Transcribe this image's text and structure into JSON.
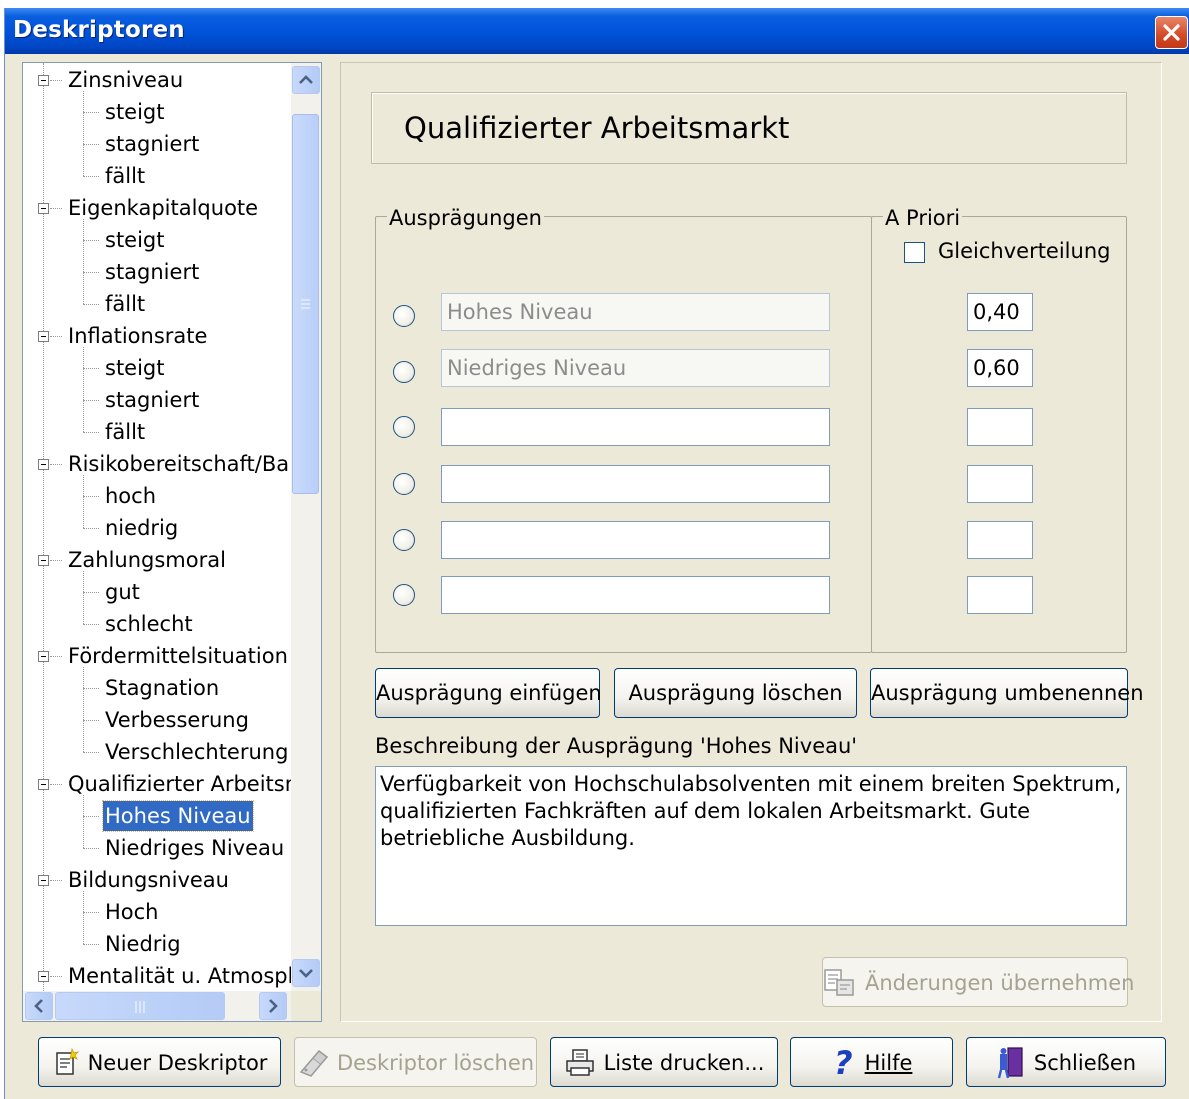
{
  "window": {
    "title": "Deskriptoren"
  },
  "tree": {
    "nodes": [
      {
        "label": "Zinsniveau",
        "children": [
          "steigt",
          "stagniert",
          "fällt"
        ]
      },
      {
        "label": "Eigenkapitalquote",
        "children": [
          "steigt",
          "stagniert",
          "fällt"
        ]
      },
      {
        "label": "Inflationsrate",
        "children": [
          "steigt",
          "stagniert",
          "fällt"
        ]
      },
      {
        "label": "Risikobereitschaft/Bank",
        "children": [
          "hoch",
          "niedrig"
        ]
      },
      {
        "label": "Zahlungsmoral",
        "children": [
          "gut",
          "schlecht"
        ]
      },
      {
        "label": "Fördermittelsituation",
        "children": [
          "Stagnation",
          "Verbesserung",
          "Verschlechterung"
        ]
      },
      {
        "label": "Qualifizierter Arbeitsmarl",
        "children": [
          "Hohes Niveau",
          "Niedriges Niveau"
        ]
      },
      {
        "label": "Bildungsniveau",
        "children": [
          "Hoch",
          "Niedrig"
        ]
      },
      {
        "label": "Mentalität u. Atmosphär",
        "children": []
      }
    ],
    "selected": "Hohes Niveau"
  },
  "heading": {
    "title": "Qualifizierter Arbeitsmarkt"
  },
  "auspraegungen": {
    "label": "Ausprägungen",
    "rows": [
      {
        "value": "Hohes Niveau",
        "prior": "0,40"
      },
      {
        "value": "Niedriges Niveau",
        "prior": "0,60"
      },
      {
        "value": "",
        "prior": ""
      },
      {
        "value": "",
        "prior": ""
      },
      {
        "value": "",
        "prior": ""
      },
      {
        "value": "",
        "prior": ""
      }
    ]
  },
  "apriori": {
    "label": "A Priori",
    "checkbox_label": "Gleichverteilung"
  },
  "buttons": {
    "insert": "Ausprägung einfügen",
    "delete": "Ausprägung löschen",
    "rename": "Ausprägung umbenennen",
    "apply": "Änderungen übernehmen"
  },
  "description": {
    "label": "Beschreibung der Ausprägung 'Hohes Niveau'",
    "text": "Verfügbarkeit von Hochschulabsolventen mit einem breiten Spektrum, qualifizierten Fachkräften auf dem lokalen Arbeitsmarkt. Gute betriebliche Ausbildung."
  },
  "footer": {
    "new": "Neuer Deskriptor",
    "delete": "Deskriptor löschen",
    "print": "Liste drucken...",
    "help": "Hilfe",
    "close": "Schließen"
  }
}
